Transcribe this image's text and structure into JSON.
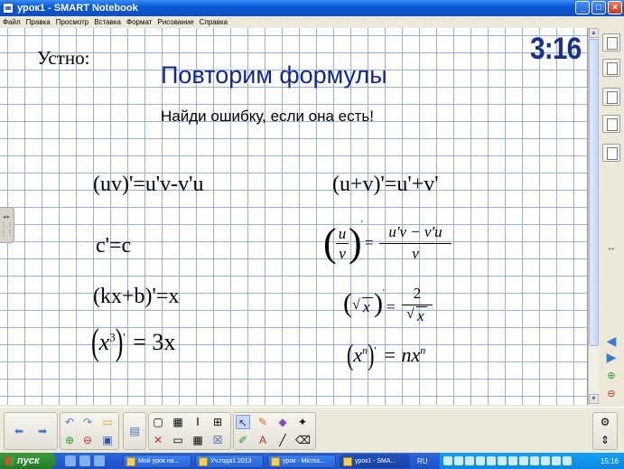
{
  "window": {
    "title": "урок1 - SMART Notebook",
    "controls": [
      "minimize",
      "maximize",
      "close"
    ]
  },
  "menu": {
    "items": [
      "Файл",
      "Правка",
      "Просмотр",
      "Вставка",
      "Формат",
      "Рисование",
      "Справка"
    ]
  },
  "slide": {
    "timer": "3:16",
    "oral_label": "Устно:",
    "heading": "Повторим формулы",
    "subtitle": "Найди ошибку, если она есть!",
    "formulas_left": [
      "(uv)'=u'v-v'u",
      "c'=c",
      "(kx+b)'=x"
    ],
    "formula_power_left": {
      "base": "x",
      "exp": "3",
      "rhs": "= 3x"
    },
    "formula_sum_right": "(u+v)'=u'+v'",
    "formula_quotient": {
      "num": "u",
      "den": "v",
      "rhs_num": "u'v − v'u",
      "rhs_den": "v"
    },
    "formula_sqrt": {
      "arg": "x",
      "rhs_num": "2",
      "rhs_den_arg": "x"
    },
    "formula_power_right": {
      "base": "x",
      "exp": "n",
      "rhs": "= nx",
      "rhs_exp": "n"
    }
  },
  "taskbar": {
    "start_label": "пуск",
    "buttons": [
      "Мой урок на...",
      "Уч.года1 2013",
      "урок - Micros...",
      "урок1 - SMA..."
    ],
    "active_index": 3,
    "language": "RU",
    "clock": "15:16"
  }
}
